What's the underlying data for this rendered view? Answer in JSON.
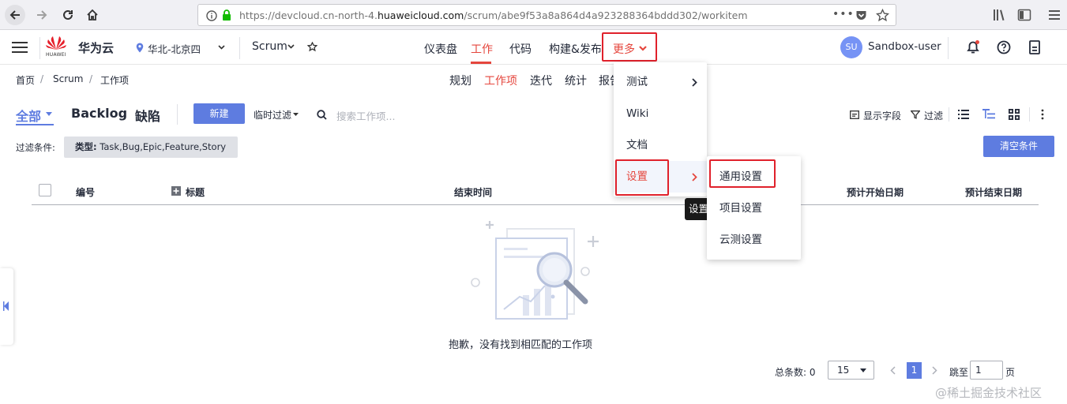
{
  "browser": {
    "url_prefix": "https://devcloud.cn-north-4.",
    "url_host": "huaweicloud.com",
    "url_path": "/scrum/abe9f53a8a864d4a923288364bddd302/workitem"
  },
  "header": {
    "brand_logo_text": "HUAWEI",
    "brand_name": "华为云",
    "region": "华北-北京四",
    "project_type": "Scrum",
    "nav": [
      "仪表盘",
      "工作",
      "代码",
      "构建&发布",
      "更多"
    ],
    "user_initials": "SU",
    "user_name": "Sandbox-user"
  },
  "breadcrumb": [
    "首页",
    "Scrum",
    "工作项"
  ],
  "subnav": [
    "规划",
    "工作项",
    "迭代",
    "统计",
    "报告"
  ],
  "toolbar": {
    "tabs": [
      "全部",
      "Backlog",
      "缺陷"
    ],
    "new_button": "新建",
    "temp_filter": "临时过滤",
    "search_placeholder": "搜索工作项...",
    "show_fields": "显示字段",
    "filter": "过滤"
  },
  "filter_row": {
    "label": "过滤条件:",
    "tag_key": "类型:",
    "tag_value": " Task,Bug,Epic,Feature,Story",
    "clear_button": "清空条件"
  },
  "table": {
    "headers": [
      "编号",
      "标题",
      "结束时间",
      "预计开始日期",
      "预计结束日期"
    ],
    "empty_text": "抱歉，没有找到相匹配的工作项"
  },
  "pagination": {
    "total_label": "总条数: 0",
    "page_size": "15",
    "current_page": "1",
    "jump_label": "跳至",
    "jump_value": "1",
    "page_unit": "页"
  },
  "more_menu": {
    "items": [
      "测试",
      "Wiki",
      "文档",
      "设置"
    ]
  },
  "settings_submenu": {
    "items": [
      "通用设置",
      "项目设置",
      "云测设置"
    ]
  },
  "tooltip": "设置",
  "watermark": "@稀土掘金技术社区",
  "colors": {
    "accent": "#5e7ce0",
    "active_red": "#e5463d",
    "highlight_box": "#e0212b"
  }
}
